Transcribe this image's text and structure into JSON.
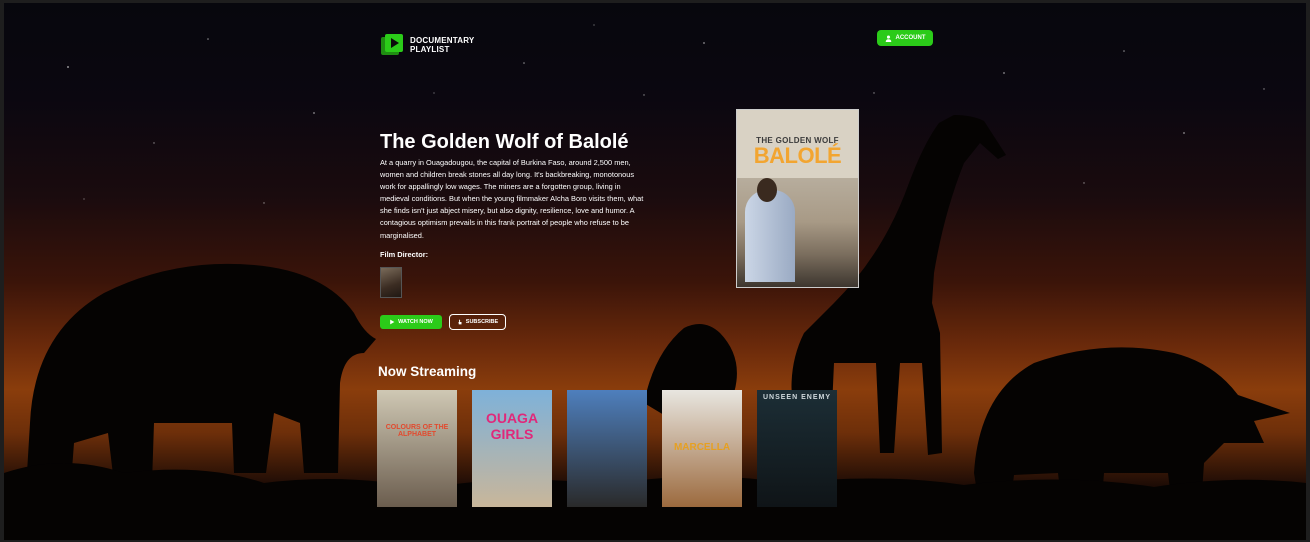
{
  "header": {
    "logo_text": "DOCUMENTARY PLAYLIST",
    "account_label": "ACCOUNT"
  },
  "hero": {
    "title": "The Golden Wolf of Balolé",
    "description": "At a quarry in Ouagadougou, the capital of Burkina Faso, around 2,500 men, women and children break stones all day long. It's backbreaking, monotonous work for appallingly low wages. The miners are a forgotten group, living in medieval conditions. But when the young filmmaker Aïcha Boro visits them, what she finds isn't just abject misery, but also dignity, resilience, love and humor. A contagious optimism prevails in this frank portrait of people who refuse to be marginalised.",
    "director_label": "Film Director:",
    "watch_label": "WATCH NOW",
    "subscribe_label": "SUBSCRIBE"
  },
  "poster": {
    "title_line1": "THE GOLDEN WOLF",
    "title_line2": "BALOLÉ"
  },
  "now_streaming": {
    "heading": "Now Streaming",
    "items": [
      {
        "label": "COLOURS OF THE ALPHABET",
        "top": "#cfc8b4",
        "bottom": "#6b5d4e",
        "text_color": "#e24a2e"
      },
      {
        "label": "OUAGA GIRLS",
        "top": "#7eb1d9",
        "bottom": "#c9b69a",
        "text_color": "#e0287a"
      },
      {
        "label": "",
        "top": "#4e7fbd",
        "bottom": "#2a2a2a",
        "text_color": "#ffffff"
      },
      {
        "label": "MARCELLA",
        "top": "#e8e6e0",
        "bottom": "#9c6a3e",
        "text_color": "#e6a021"
      },
      {
        "label": "UNSEEN ENEMY",
        "top": "#1c2e36",
        "bottom": "#0f1417",
        "text_color": "#cfd8dc"
      }
    ]
  },
  "colors": {
    "accent": "#2bcb19"
  }
}
